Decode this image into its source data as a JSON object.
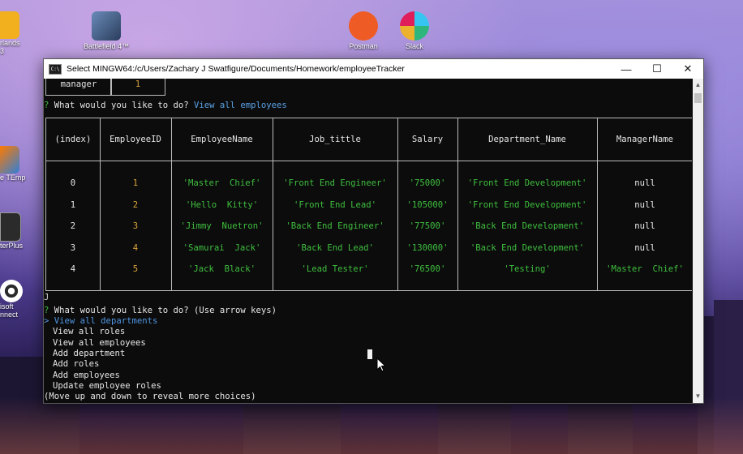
{
  "desktop": {
    "icons": [
      {
        "label": "Battlefield 4™",
        "color": "#3b5a86"
      },
      {
        "label": "Postman",
        "color": "#ef5b25"
      },
      {
        "label": "Slack",
        "color": "#ffffff"
      }
    ],
    "left_icons": [
      {
        "label": "rlands 3",
        "color": "#f2b01e"
      },
      {
        "label": "e TEmp",
        "color": "#2f7fd8"
      },
      {
        "label": "terPlus",
        "color": "#2b2b2b"
      },
      {
        "label": "isoft",
        "label2": "nnect",
        "color": "#2a2a2a"
      }
    ]
  },
  "window": {
    "title": "Select MINGW64:/c/Users/Zachary J Swatfigure/Documents/Homework/employeeTracker",
    "icon_text": "C:\\",
    "minimize": "—",
    "maximize": "☐",
    "close": "✕"
  },
  "terminal": {
    "old_row": {
      "col1": "manager",
      "col2": "1"
    },
    "prompt1": {
      "mark": "?",
      "question": "What would you like to do?",
      "answer": "View all employees"
    },
    "table": {
      "headers": [
        "(index)",
        "EmployeeID",
        "EmployeeName",
        "Job_tittle",
        "Salary",
        "Department_Name",
        "ManagerName"
      ],
      "rows": [
        [
          "0",
          "1",
          "'Master  Chief'",
          "'Front End Engineer'",
          "'75000'",
          "'Front End Development'",
          "null"
        ],
        [
          "1",
          "2",
          "'Hello  Kitty'",
          "'Front End Lead'",
          "'105000'",
          "'Front End Development'",
          "null"
        ],
        [
          "2",
          "3",
          "'Jimmy  Nuetron'",
          "'Back End Engineer'",
          "'77500'",
          "'Back End Development'",
          "null"
        ],
        [
          "3",
          "4",
          "'Samurai  Jack'",
          "'Back End Lead'",
          "'130000'",
          "'Back End Development'",
          "null"
        ],
        [
          "4",
          "5",
          "'Jack  Black'",
          "'Lead Tester'",
          "'76500'",
          "'Testing'",
          "'Master  Chief'"
        ]
      ]
    },
    "stray": "J",
    "prompt2": {
      "mark": "?",
      "question": "What would you like to do?",
      "hint": "(Use arrow keys)"
    },
    "pointer": ">",
    "choices": [
      "View all departments",
      "View all roles",
      "View all employees",
      "Add department",
      "Add roles",
      "Add employees",
      "Update employee roles"
    ],
    "footer": "(Move up and down to reveal more choices)",
    "scroll_up": "▲",
    "scroll_down": "▼"
  }
}
